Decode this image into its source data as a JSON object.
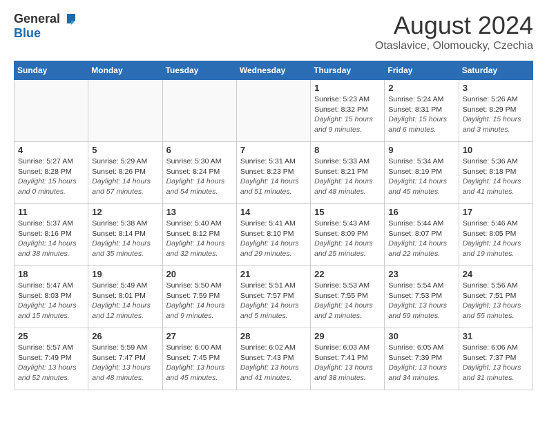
{
  "header": {
    "logo_general": "General",
    "logo_blue": "Blue",
    "month_title": "August 2024",
    "subtitle": "Otaslavice, Olomoucky, Czechia"
  },
  "days_of_week": [
    "Sunday",
    "Monday",
    "Tuesday",
    "Wednesday",
    "Thursday",
    "Friday",
    "Saturday"
  ],
  "weeks": [
    [
      {
        "day": "",
        "info": ""
      },
      {
        "day": "",
        "info": ""
      },
      {
        "day": "",
        "info": ""
      },
      {
        "day": "",
        "info": ""
      },
      {
        "day": "1",
        "sunrise": "5:23 AM",
        "sunset": "8:32 PM",
        "daylight": "15 hours and 9 minutes."
      },
      {
        "day": "2",
        "sunrise": "5:24 AM",
        "sunset": "8:31 PM",
        "daylight": "15 hours and 6 minutes."
      },
      {
        "day": "3",
        "sunrise": "5:26 AM",
        "sunset": "8:29 PM",
        "daylight": "15 hours and 3 minutes."
      }
    ],
    [
      {
        "day": "4",
        "sunrise": "5:27 AM",
        "sunset": "8:28 PM",
        "daylight": "15 hours and 0 minutes."
      },
      {
        "day": "5",
        "sunrise": "5:29 AM",
        "sunset": "8:26 PM",
        "daylight": "14 hours and 57 minutes."
      },
      {
        "day": "6",
        "sunrise": "5:30 AM",
        "sunset": "8:24 PM",
        "daylight": "14 hours and 54 minutes."
      },
      {
        "day": "7",
        "sunrise": "5:31 AM",
        "sunset": "8:23 PM",
        "daylight": "14 hours and 51 minutes."
      },
      {
        "day": "8",
        "sunrise": "5:33 AM",
        "sunset": "8:21 PM",
        "daylight": "14 hours and 48 minutes."
      },
      {
        "day": "9",
        "sunrise": "5:34 AM",
        "sunset": "8:19 PM",
        "daylight": "14 hours and 45 minutes."
      },
      {
        "day": "10",
        "sunrise": "5:36 AM",
        "sunset": "8:18 PM",
        "daylight": "14 hours and 41 minutes."
      }
    ],
    [
      {
        "day": "11",
        "sunrise": "5:37 AM",
        "sunset": "8:16 PM",
        "daylight": "14 hours and 38 minutes."
      },
      {
        "day": "12",
        "sunrise": "5:38 AM",
        "sunset": "8:14 PM",
        "daylight": "14 hours and 35 minutes."
      },
      {
        "day": "13",
        "sunrise": "5:40 AM",
        "sunset": "8:12 PM",
        "daylight": "14 hours and 32 minutes."
      },
      {
        "day": "14",
        "sunrise": "5:41 AM",
        "sunset": "8:10 PM",
        "daylight": "14 hours and 29 minutes."
      },
      {
        "day": "15",
        "sunrise": "5:43 AM",
        "sunset": "8:09 PM",
        "daylight": "14 hours and 25 minutes."
      },
      {
        "day": "16",
        "sunrise": "5:44 AM",
        "sunset": "8:07 PM",
        "daylight": "14 hours and 22 minutes."
      },
      {
        "day": "17",
        "sunrise": "5:46 AM",
        "sunset": "8:05 PM",
        "daylight": "14 hours and 19 minutes."
      }
    ],
    [
      {
        "day": "18",
        "sunrise": "5:47 AM",
        "sunset": "8:03 PM",
        "daylight": "14 hours and 15 minutes."
      },
      {
        "day": "19",
        "sunrise": "5:49 AM",
        "sunset": "8:01 PM",
        "daylight": "14 hours and 12 minutes."
      },
      {
        "day": "20",
        "sunrise": "5:50 AM",
        "sunset": "7:59 PM",
        "daylight": "14 hours and 9 minutes."
      },
      {
        "day": "21",
        "sunrise": "5:51 AM",
        "sunset": "7:57 PM",
        "daylight": "14 hours and 5 minutes."
      },
      {
        "day": "22",
        "sunrise": "5:53 AM",
        "sunset": "7:55 PM",
        "daylight": "14 hours and 2 minutes."
      },
      {
        "day": "23",
        "sunrise": "5:54 AM",
        "sunset": "7:53 PM",
        "daylight": "13 hours and 59 minutes."
      },
      {
        "day": "24",
        "sunrise": "5:56 AM",
        "sunset": "7:51 PM",
        "daylight": "13 hours and 55 minutes."
      }
    ],
    [
      {
        "day": "25",
        "sunrise": "5:57 AM",
        "sunset": "7:49 PM",
        "daylight": "13 hours and 52 minutes."
      },
      {
        "day": "26",
        "sunrise": "5:59 AM",
        "sunset": "7:47 PM",
        "daylight": "13 hours and 48 minutes."
      },
      {
        "day": "27",
        "sunrise": "6:00 AM",
        "sunset": "7:45 PM",
        "daylight": "13 hours and 45 minutes."
      },
      {
        "day": "28",
        "sunrise": "6:02 AM",
        "sunset": "7:43 PM",
        "daylight": "13 hours and 41 minutes."
      },
      {
        "day": "29",
        "sunrise": "6:03 AM",
        "sunset": "7:41 PM",
        "daylight": "13 hours and 38 minutes."
      },
      {
        "day": "30",
        "sunrise": "6:05 AM",
        "sunset": "7:39 PM",
        "daylight": "13 hours and 34 minutes."
      },
      {
        "day": "31",
        "sunrise": "6:06 AM",
        "sunset": "7:37 PM",
        "daylight": "13 hours and 31 minutes."
      }
    ]
  ],
  "labels": {
    "sunrise": "Sunrise:",
    "sunset": "Sunset:",
    "daylight": "Daylight:"
  }
}
